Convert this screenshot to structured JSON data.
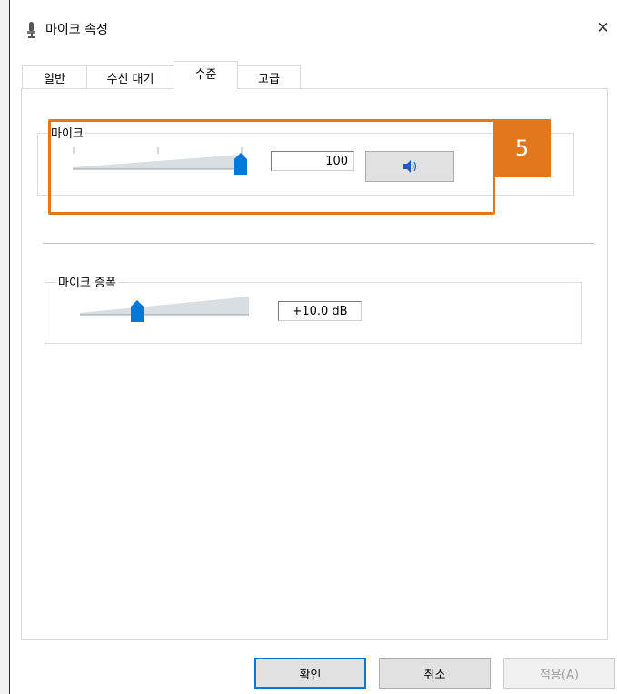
{
  "window": {
    "title": "마이크 속성",
    "close_glyph": "✕"
  },
  "tabs": [
    {
      "label": "일반",
      "active": false
    },
    {
      "label": "수신 대기",
      "active": false
    },
    {
      "label": "수준",
      "active": true
    },
    {
      "label": "고급",
      "active": false
    }
  ],
  "microphone": {
    "label": "마이크",
    "level": 100,
    "value_text": "100",
    "mute_icon": "speaker-icon"
  },
  "boost": {
    "label": "마이크 증폭",
    "value_text": "+10.0 dB",
    "level_fraction": 0.33
  },
  "annotation": {
    "badge": "5"
  },
  "buttons": {
    "ok": "확인",
    "cancel": "취소",
    "apply": "적용(A)"
  },
  "colors": {
    "accent": "#0078d7",
    "highlight": "#e1781e"
  }
}
